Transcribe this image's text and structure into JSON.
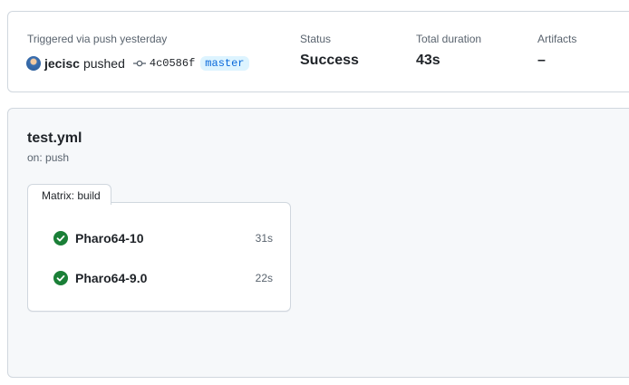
{
  "summary": {
    "trigger_label": "Triggered via push yesterday",
    "actor": "jecisc",
    "action": "pushed",
    "commit_sha": "4c0586f",
    "branch": "master",
    "status_label": "Status",
    "status_value": "Success",
    "duration_label": "Total duration",
    "duration_value": "43s",
    "artifacts_label": "Artifacts",
    "artifacts_value": "–"
  },
  "workflow": {
    "name": "test.yml",
    "trigger": "on: push",
    "matrix_label": "Matrix: build",
    "jobs": [
      {
        "name": "Pharo64-10",
        "duration": "31s",
        "status": "success"
      },
      {
        "name": "Pharo64-9.0",
        "duration": "22s",
        "status": "success"
      }
    ]
  },
  "colors": {
    "success": "#1a7f37",
    "branch_bg": "#ddf4ff",
    "branch_fg": "#0969da"
  }
}
